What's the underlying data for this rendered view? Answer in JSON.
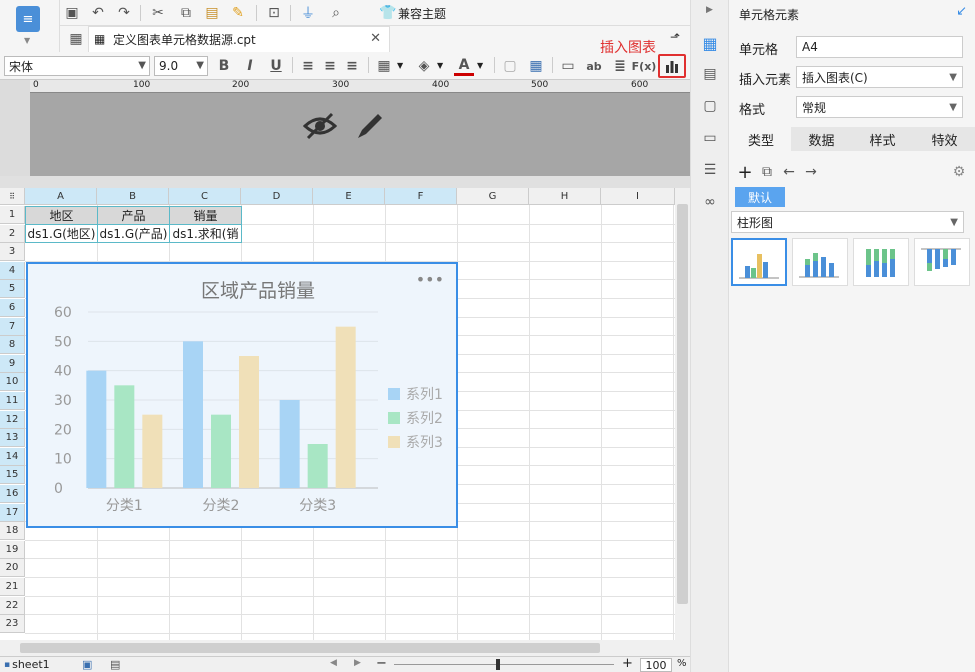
{
  "toolbar": {
    "compat_theme": "兼容主题"
  },
  "tab": {
    "filename": "定义图表单元格数据源.cpt"
  },
  "format": {
    "font": "宋体",
    "size": "9.0"
  },
  "insert_chart_tip": "插入图表",
  "ruler": {
    "marks": [
      "0",
      "100",
      "200",
      "300",
      "400",
      "500",
      "600"
    ]
  },
  "columns": [
    "A",
    "B",
    "C",
    "D",
    "E",
    "F",
    "G",
    "H",
    "I"
  ],
  "rows": [
    "1",
    "2",
    "3",
    "4",
    "5",
    "6",
    "7",
    "8",
    "9",
    "10",
    "11",
    "12",
    "13",
    "14",
    "15",
    "16",
    "17",
    "18",
    "19",
    "20",
    "21",
    "22",
    "23"
  ],
  "cells": {
    "a1": "地区",
    "b1": "产品",
    "c1": "销量",
    "a2": "ds1.G(地区)",
    "b2": "ds1.G(产品)",
    "c2": "ds1.求和(销"
  },
  "chart_data": {
    "type": "bar",
    "title": "区域产品销量",
    "categories": [
      "分类1",
      "分类2",
      "分类3"
    ],
    "series": [
      {
        "name": "系列1",
        "values": [
          40,
          50,
          30
        ],
        "color": "#a8d4f5"
      },
      {
        "name": "系列2",
        "values": [
          35,
          25,
          15
        ],
        "color": "#a8e6c4"
      },
      {
        "name": "系列3",
        "values": [
          25,
          45,
          55
        ],
        "color": "#f0e0b8"
      }
    ],
    "ylim": [
      0,
      60
    ],
    "yticks": [
      "0",
      "10",
      "20",
      "30",
      "40",
      "50",
      "60"
    ],
    "legend": "right"
  },
  "panel": {
    "title": "单元格元素",
    "cell_label": "单元格",
    "cell_value": "A4",
    "insert_label": "插入元素",
    "insert_value": "插入图表(C)",
    "format_label": "格式",
    "format_value": "常规",
    "tabs": [
      "类型",
      "数据",
      "样式",
      "特效"
    ],
    "default_btn": "默认",
    "chart_type": "柱形图"
  },
  "status": {
    "sheet": "sheet1",
    "zoom": "100",
    "percent": "%"
  }
}
